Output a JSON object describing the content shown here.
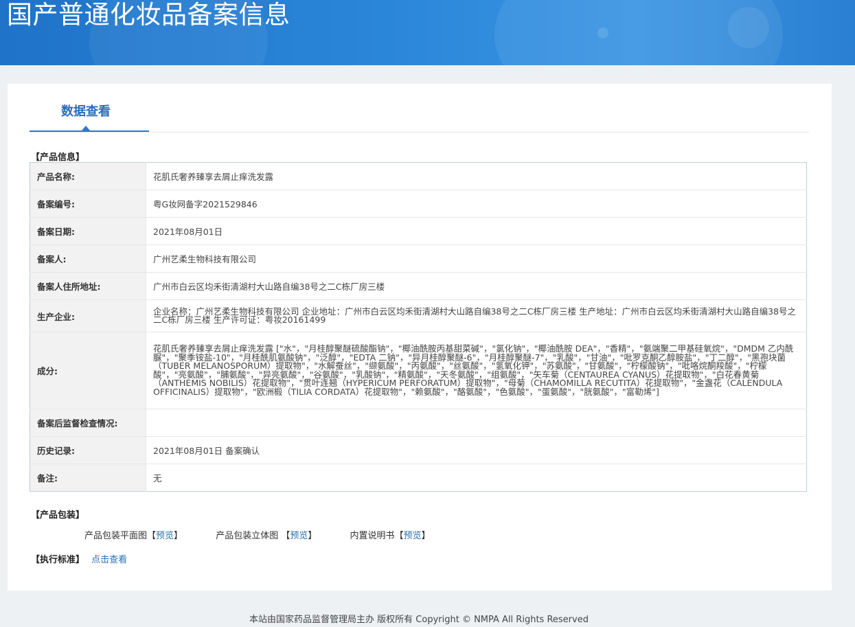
{
  "header": {
    "title": "国产普通化妆品备案信息"
  },
  "tabs": [
    {
      "label": "数据查看"
    }
  ],
  "product_info": {
    "section_title": "【产品信息】",
    "rows": [
      {
        "label": "产品名称:",
        "value": "花肌氏奢养臻享去屑止痒洗发露"
      },
      {
        "label": "备案编号:",
        "value": "粤G妆网备字2021529846"
      },
      {
        "label": "备案日期:",
        "value": "2021年08月01日"
      },
      {
        "label": "备案人:",
        "value": "广州艺柔生物科技有限公司"
      },
      {
        "label": "备案人住所地址:",
        "value": "广州市白云区均禾街清湖村大山路自编38号之二C栋厂房三楼"
      },
      {
        "label": "生产企业:",
        "value": "企业名称：广州艺柔生物科技有限公司 企业地址：广州市白云区均禾街清湖村大山路自编38号之二C栋厂房三楼 生产地址：广州市白云区均禾街清湖村大山路自编38号之二C栋厂房三楼 生产许可证：粤妆20161499"
      },
      {
        "label": "成分:",
        "value": "花肌氏奢养臻享去屑止痒洗发露 [\"水\"，\"月桂醇聚醚硫酸酯钠\"，\"椰油酰胺丙基甜菜碱\"，\"氯化钠\"，\"椰油酰胺 DEA\"，\"香精\"，\"氨端聚二甲基硅氧烷\"，\"DMDM 乙内酰脲\"，\"聚季铵盐-10\"，\"月桂酰肌氨酸钠\"，\"泛醇\"，\"EDTA 二钠\"，\"异月桂醇聚醚-6\"，\"月桂醇聚醚-7\"，\"乳酸\"，\"甘油\"，\"吡罗克酮乙醇胺盐\"，\"丁二醇\"，\"黑孢块菌（TUBER MELANOSPORUM）提取物\"，\"水解蚕丝\"，\"缬氨酸\"，\"丙氨酸\"，\"丝氨酸\"，\"氢氧化钾\"，\"苏氨酸\"，\"甘氨酸\"，\"柠檬酸钠\"，\"吡咯烷酮羧酸\"，\"柠檬酸\"，\"亮氨酸\"，\"脯氨酸\"，\"异亮氨酸\"，\"谷氨酸\"，\"乳酸钠\"，\"精氨酸\"，\"天冬氨酸\"，\"组氨酸\"，\"矢车菊（CENTAUREA CYANUS）花提取物\"，\"白花春黄菊（ANTHEMIS NOBILIS）花提取物\"，\"贯叶连翘（HYPERICUM PERFORATUM）提取物\"，\"母菊（CHAMOMILLA RECUTITA）花提取物\"，\"金盏花（CALENDULA OFFICINALIS）提取物\"，\"欧洲椴（TILIA CORDATA）花提取物\"，\"赖氨酸\"，\"酪氨酸\"，\"色氨酸\"，\"蛋氨酸\"，\"胱氨酸\"，\"富勒烯\"]"
      },
      {
        "label": "备案后监督检查情况:",
        "value": ""
      },
      {
        "label": "历史记录:",
        "value": "2021年08月01日 备案确认"
      },
      {
        "label": "备注:",
        "value": "无"
      }
    ]
  },
  "packaging": {
    "section_title": "【产品包装】",
    "items": [
      {
        "label": "产品包装平面图",
        "open": "【",
        "link": "预览",
        "close": "】"
      },
      {
        "label": "产品包装立体图 ",
        "open": "【",
        "link": "预览",
        "close": "】"
      },
      {
        "label": "内置说明书",
        "open": "【",
        "link": "预览",
        "close": "】"
      }
    ]
  },
  "standard": {
    "section_title": "【执行标准】",
    "link": "点击查看"
  },
  "footer": {
    "text": "本站由国家药品监督管理局主办 版权所有 Copyright © NMPA All Rights Reserved"
  },
  "colors": {
    "banner": "#2a86d9",
    "accent": "#2a6fb5",
    "link": "#2a6fb5"
  }
}
